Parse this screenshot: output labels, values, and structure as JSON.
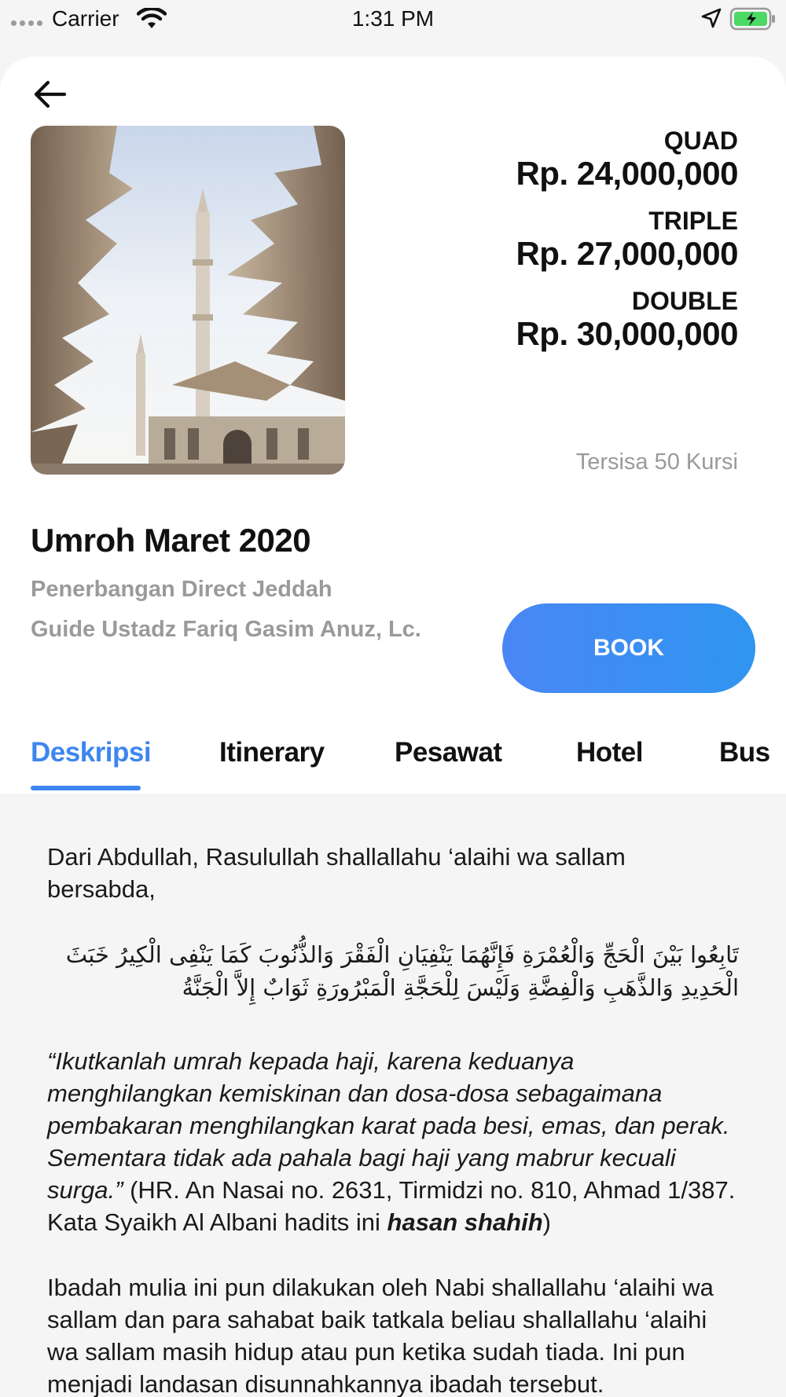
{
  "status_bar": {
    "carrier": "Carrier",
    "time": "1:31 PM"
  },
  "package": {
    "title": "Umroh Maret 2020",
    "flight": "Penerbangan Direct Jeddah",
    "guide": "Guide Ustadz Fariq Gasim Anuz, Lc.",
    "seats_left": "Tersisa 50 Kursi",
    "book_label": "BOOK",
    "prices": [
      {
        "type": "QUAD",
        "value": "Rp. 24,000,000"
      },
      {
        "type": "TRIPLE",
        "value": "Rp. 27,000,000"
      },
      {
        "type": "DOUBLE",
        "value": "Rp. 30,000,000"
      }
    ]
  },
  "tabs": [
    "Deskripsi",
    "Itinerary",
    "Pesawat",
    "Hotel",
    "Bus"
  ],
  "content": {
    "intro": "Dari Abdullah, Rasulullah shallallahu ‘alaihi wa sallam bersabda,",
    "arabic": "تَابِعُوا بَيْنَ الْحَجِّ وَالْعُمْرَةِ فَإِنَّهُمَا يَنْفِيَانِ الْفَقْرَ وَالذُّنُوبَ كَمَا يَنْفِى الْكِيرُ خَبَثَ الْحَدِيدِ وَالذَّهَبِ وَالْفِضَّةِ وَلَيْسَ لِلْحَجَّةِ الْمَبْرُورَةِ ثَوَابٌ إِلاَّ الْجَنَّةُ",
    "quote_italic": "“Ikutkanlah umrah kepada haji, karena keduanya menghilangkan kemiskinan dan dosa-dosa sebagaimana pembakaran menghilangkan karat pada besi, emas, dan perak. Sementara tidak ada pahala bagi haji yang mabrur kecuali surga.”",
    "quote_source": " (HR. An Nasai no. 2631, Tirmidzi no. 810, Ahmad 1/387. Kata Syaikh Al Albani hadits ini ",
    "quote_grade": "hasan shahih",
    "quote_close": ")",
    "para2": "Ibadah mulia ini pun dilakukan oleh Nabi shallallahu ‘alaihi wa sallam dan para sahabat baik tatkala beliau shallallahu ‘alaihi wa sallam masih hidup atau pun ketika sudah tiada. Ini pun menjadi landasan disunnahkannya ibadah tersebut."
  },
  "colors": {
    "accent": "#3d86f0",
    "muted": "#9a9a9a",
    "battery": "#4cd964"
  }
}
